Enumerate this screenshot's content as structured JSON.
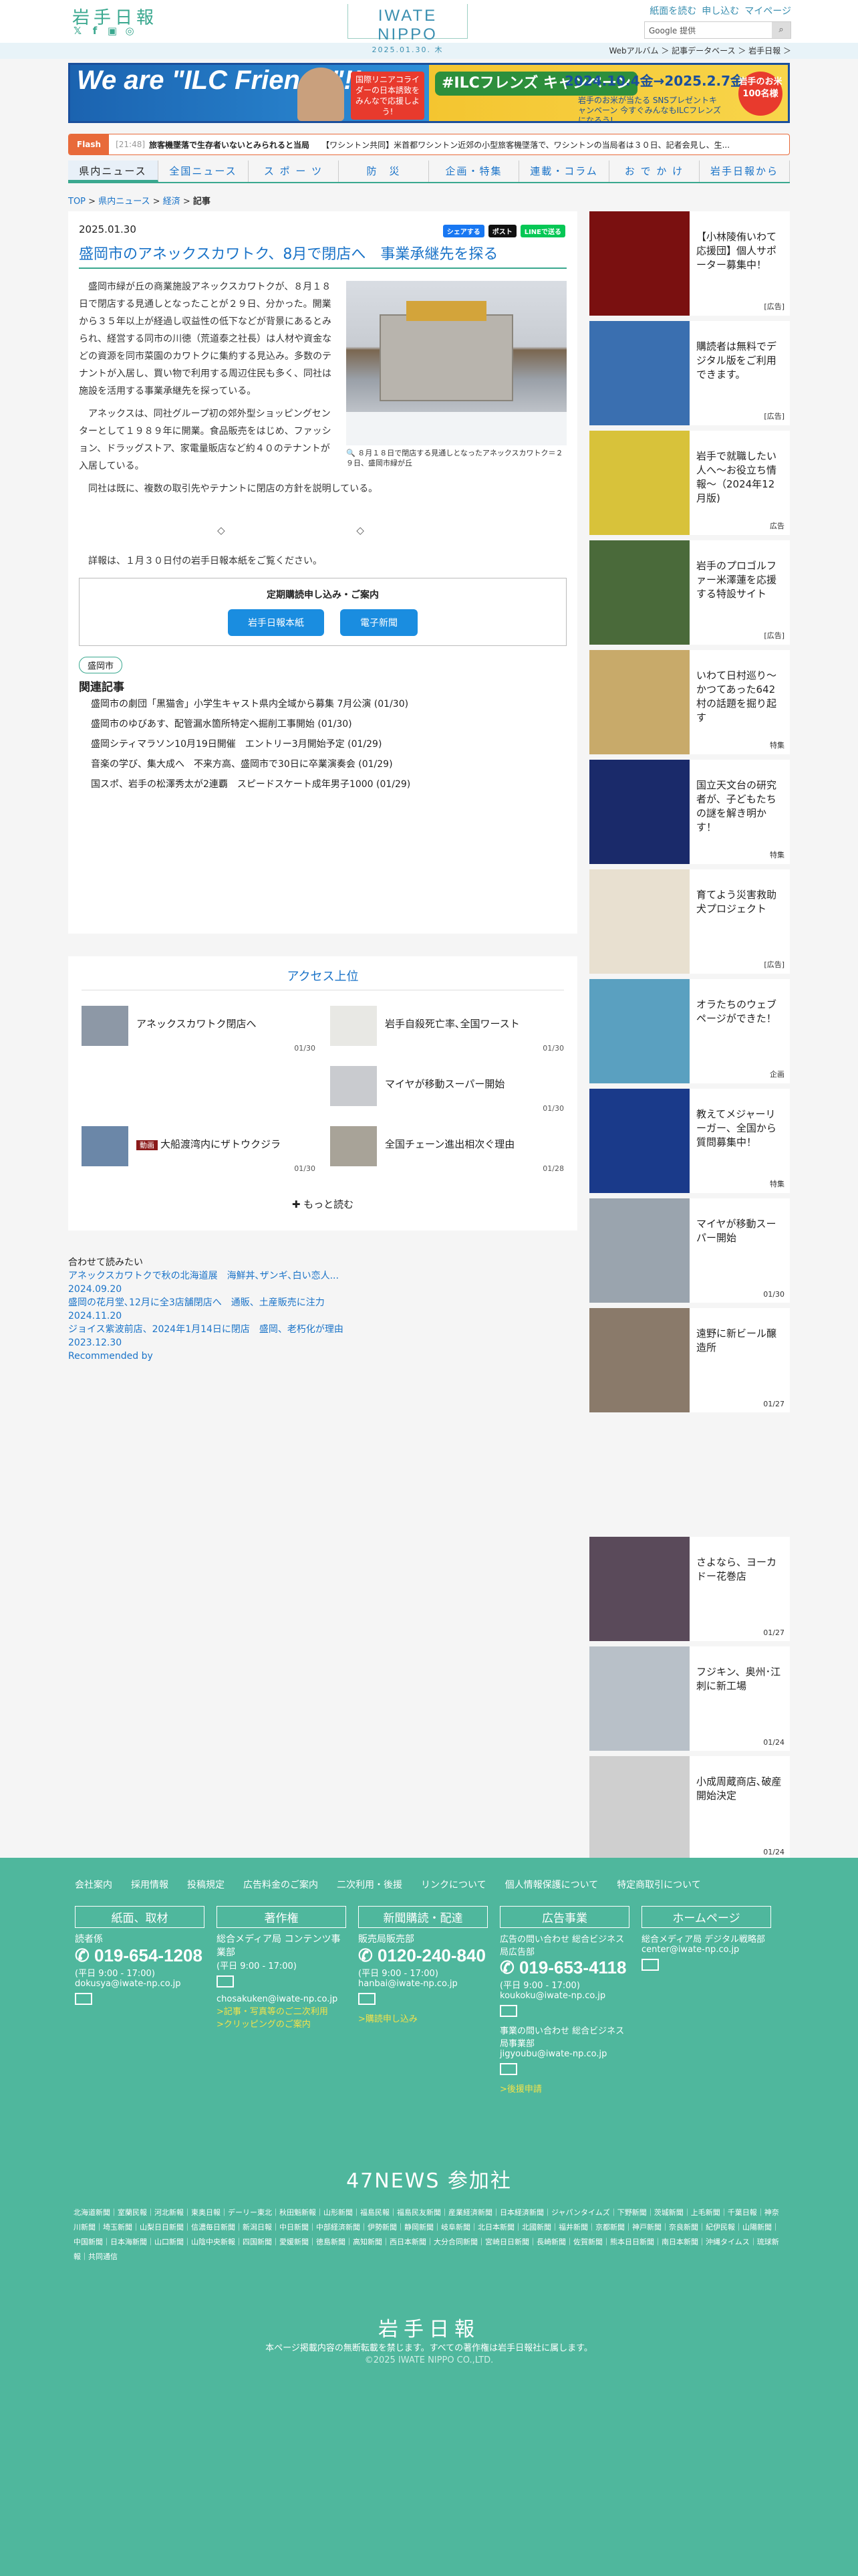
{
  "header": {
    "logo_jp": "岩手日報",
    "brand": "IWATE NIPPO",
    "date": "2025.01.30. 木",
    "links": [
      "紙面を読む",
      "申し込む",
      "マイページ"
    ],
    "search_placeholder": "Google 提供",
    "subbar": "Webアルバム ＞ 記事データベース ＞ 岩手日報 ＞"
  },
  "banner": {
    "headline": "We are \"ILC Friends\"!!",
    "mid": "国際リニアコライダーの日本誘致をみんなで応援しよう!",
    "campaign": "#ILCフレンズ キャンペーン",
    "dates": "2024.10.4金→2025.2.7金",
    "detail": "岩手のお米が当たる SNSプレゼントキャンペーン 今すぐみんなもILCフレンズになろう!",
    "circle": "岩手のお米 100名様"
  },
  "flash": {
    "label": "Flash",
    "time": "[21:48]",
    "item1": "旅客機墜落で生存者いないとみられると当局",
    "item2": "【ワシントン共同】米首都ワシントン近郊の小型旅客機墜落で、ワシントンの当局者は３０日、記者会見し、生..."
  },
  "nav": [
    "県内ニュース",
    "全国ニュース",
    "ス ポ ー ツ",
    "防　災",
    "企画・特集",
    "連載・コラム",
    "お で か け",
    "岩手日報から"
  ],
  "breadcrumb": {
    "top": "TOP",
    "cat1": "県内ニュース",
    "cat2": "経済",
    "current": "記事"
  },
  "article": {
    "date": "2025.01.30",
    "share": [
      "シェアする",
      "ポスト",
      "LINEで送る"
    ],
    "title": "盛岡市のアネックスカワトク、8月で閉店へ　事業承継先を探る",
    "photo_caption": "８月１８日で閉店する見通しとなったアネックスカワトク＝２９日、盛岡市緑が丘",
    "p1": "盛岡市緑が丘の商業施設アネックスカワトクが、８月１８日で閉店する見通しとなったことが２９日、分かった。開業から３５年以上が経過し収益性の低下などが背景にあるとみられ、経営する同市の川徳（荒道泰之社長）は人材や資金などの資源を同市菜園のカワトクに集約する見込み。多数のテナントが入居し、買い物で利用する周辺住民も多く、同社は施設を活用する事業承継先を探っている。",
    "p2": "アネックスは、同社グループ初の郊外型ショッピングセンターとして１９８９年に開業。食品販売をはじめ、ファッション、ドラッグストア、家電量販店など約４０のテナントが入居している。",
    "p3": "同社は既に、複数の取引先やテナントに閉店の方針を説明している。",
    "diamonds": "◇ ◇",
    "p4": "詳報は、１月３０日付の岩手日報本紙をご覧ください。",
    "subs_title": "定期購読申し込み・ご案内",
    "subs_btn1": "岩手日報本紙",
    "subs_btn2": "電子新聞",
    "tag": "盛岡市",
    "related_heading": "関連記事",
    "related": [
      "盛岡市の劇団「黒猫舎」小学生キャスト県内全域から募集 7月公演 (01/30)",
      "盛岡市のゆびあす、配管漏水箇所特定へ掘削工事開始 (01/30)",
      "盛岡シティマラソン10月19日開催　エントリー3月開始予定 (01/29)",
      "音楽の学び、集大成へ　不来方高、盛岡市で30日に卒業演奏会 (01/29)",
      "国スポ、岩手の松澤秀太が2連覇　スピードスケート成年男子1000 (01/29)"
    ]
  },
  "access": {
    "heading": "アクセス上位",
    "items": [
      {
        "title": "アネックスカワトク閉店へ",
        "date": "01/30"
      },
      {
        "title": "岩手自殺死亡率､全国ワースト",
        "date": "01/30"
      },
      {
        "title": "マイヤが移動スーパー開始",
        "date": "01/30"
      },
      {
        "badge": "動画",
        "title": "大船渡湾内にザトウクジラ",
        "date": "01/30"
      },
      {
        "title": "全国チェーン進出相次ぐ理由",
        "date": "01/28"
      }
    ],
    "more": "もっと読む"
  },
  "recommend": {
    "heading": "合わせて読みたい",
    "l1": "アネックスカワトクで秋の北海道展　海鮮丼､ザンギ､白い恋人...",
    "d1": "2024.09.20",
    "l2": "盛岡の花月堂､12月に全3店舗閉店へ　通販、土産販売に注力",
    "d2": "2024.11.20",
    "l3": "ジョイス紫波前店、2024年1月14日に閉店　盛岡、老朽化が理由",
    "d3": "2023.12.30",
    "powered": "Recommended by"
  },
  "sidebar": [
    {
      "text": "【小林陵侑いわて応援団】個人サポーター募集中！",
      "label": "[広告]",
      "color": "#7a1010"
    },
    {
      "text": "購読者は無料でデジタル版をご利用できます。",
      "label": "[広告]",
      "color": "#3a6fb0"
    },
    {
      "text": "岩手で就職したい人へ～お役立ち情報～（2024年12月版)",
      "label": "広告",
      "color": "#d8c23a"
    },
    {
      "text": "岩手のプロゴルファー米澤蓮を応援する特設サイト",
      "label": "[広告]",
      "color": "#4a6a3a"
    },
    {
      "text": "いわて日村巡り～かつてあった642村の話題を掘り起す",
      "label": "特集",
      "color": "#c8aa6a"
    },
    {
      "text": "国立天文台の研究者が、子どもたちの謎を解き明かす！",
      "label": "特集",
      "color": "#1a2a6a"
    },
    {
      "text": "育てよう災害救助犬プロジェクト",
      "label": "[広告]",
      "color": "#e8e0d0"
    },
    {
      "text": "オラたちのウェブページができた！",
      "label": "企画",
      "color": "#5aa0c0"
    },
    {
      "text": "教えてメジャーリーガー、全国から質問募集中！",
      "label": "特集",
      "color": "#1a3a8a"
    },
    {
      "text": "マイヤが移動スーパー開始",
      "label": "01/30",
      "color": "#9aa4ae"
    },
    {
      "text": "遠野に新ビール醸造所",
      "label": "01/27",
      "color": "#8a7a6a"
    },
    {
      "text": "さよなら、ヨーカドー花巻店",
      "label": "01/27",
      "color": "#5a4a5a"
    },
    {
      "text": "フジキン、奥州･江刺に新工場",
      "label": "01/24",
      "color": "#b8c0c8"
    },
    {
      "text": "小成周蔵商店､破産開始決定",
      "label": "01/24",
      "color": "#cfcfcf"
    }
  ],
  "footer": {
    "links": [
      "会社案内",
      "採用情報",
      "投稿規定",
      "広告料金のご案内",
      "二次利用・後援",
      "リンクについて",
      "個人情報保護について",
      "特定商取引について"
    ],
    "cols": [
      {
        "head": "紙面、取材",
        "l1": "読者係",
        "tel": "019-654-1208",
        "hours": "(平日 9:00 - 17:00)",
        "mail": "dokusya@iwate-np.co.jp"
      },
      {
        "head": "著作権",
        "l1": "総合メディア局 コンテンツ事業部",
        "hours": "(平日 9:00 - 17:00)",
        "mail": "chosakuken@iwate-np.co.jp",
        "y1": ">記事・写真等のご二次利用",
        "y2": ">クリッピングのご案内"
      },
      {
        "head": "新聞購読・配達",
        "l1": "販売局販売部",
        "tel": "0120-240-840",
        "hours": "(平日 9:00 - 17:00)",
        "mail": "hanbai@iwate-np.co.jp",
        "y1": ">購読申し込み"
      },
      {
        "head": "広告事業",
        "l1": "広告の問い合わせ 総合ビジネス局広告部",
        "tel": "019-653-4118",
        "hours": "(平日 9:00 - 17:00)",
        "mail": "koukoku@iwate-np.co.jp",
        "l2": "事業の問い合わせ 総合ビジネス局事業部",
        "mail2": "jigyoubu@iwate-np.co.jp",
        "y1": ">後援申請"
      },
      {
        "head": "ホームページ",
        "l1": "総合メディア局 デジタル戦略部",
        "mail": "center@iwate-np.co.jp"
      }
    ],
    "f47": "47NEWS 参加社",
    "newspapers": "北海道新聞｜室蘭民報｜河北新報｜東奥日報｜デーリー東北｜秋田魁新報｜山形新聞｜福島民報｜福島民友新聞｜産業経済新聞｜日本経済新聞｜ジャパンタイムズ｜下野新聞｜茨城新聞｜上毛新聞｜千葉日報｜神奈川新聞｜埼玉新聞｜山梨日日新聞｜信濃毎日新聞｜新潟日報｜中日新聞｜中部経済新聞｜伊勢新聞｜静岡新聞｜岐阜新聞｜北日本新聞｜北國新聞｜福井新聞｜京都新聞｜神戸新聞｜奈良新聞｜紀伊民報｜山陽新聞｜中国新聞｜日本海新聞｜山口新聞｜山陰中央新報｜四国新聞｜愛媛新聞｜徳島新聞｜高知新聞｜西日本新聞｜大分合同新聞｜宮崎日日新聞｜長崎新聞｜佐賀新聞｜熊本日日新聞｜南日本新聞｜沖縄タイムス｜琉球新報｜共同通信",
    "logo": "岩手日報",
    "copy": "本ページ掲載内容の無断転載を禁じます。すべての著作権は岩手日報社に属します。",
    "copy2": "©2025 IWATE NIPPO CO.,LTD."
  }
}
